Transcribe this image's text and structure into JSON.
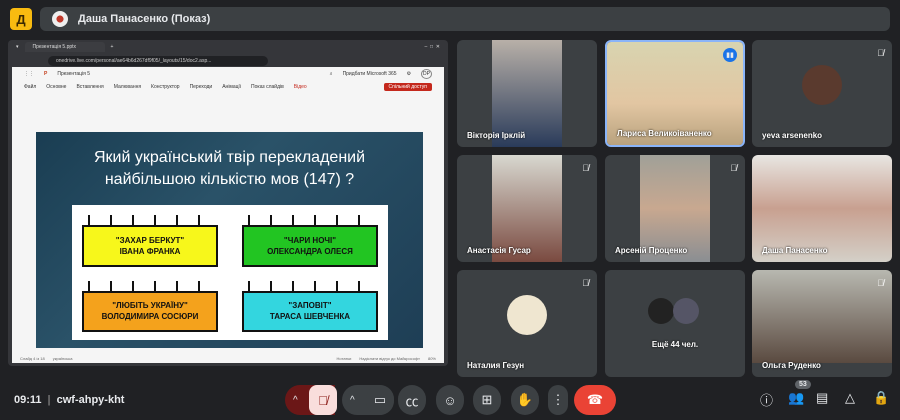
{
  "header": {
    "logo_letter": "Д",
    "presenter": "Даша Панасенко (Показ)"
  },
  "browser": {
    "tab_title": "Презентація 5.pptx",
    "url": "onedrive.live.com/personal/ae64b6d267df9f05/_layouts/15/doc2.asp...",
    "doc_name": "Презентація 5",
    "buy_label": "Придбати Microsoft 365",
    "user_initials": "DP",
    "menu": [
      "Файл",
      "Основне",
      "Вставлення",
      "Малювання",
      "Конструктор",
      "Переходи",
      "Анімації",
      "Показ слайдів",
      "Відео"
    ],
    "share_label": "Спільний доступ",
    "status_left": [
      "Слайд 4 із 18",
      "українська"
    ],
    "status_right": [
      "Нотатки",
      "Надіслати відгук до Майкрософт"
    ],
    "zoom": "80%"
  },
  "slide": {
    "question_line1": "Який український твір перекладений",
    "question_line2": "найбільшою кількістю мов (147) ?",
    "options": [
      {
        "l1": "\"ЗАХАР БЕРКУТ\"",
        "l2": "ІВАНА ФРАНКА",
        "color": "#f7f71b"
      },
      {
        "l1": "\"ЧАРИ НОЧІ\"",
        "l2": "ОЛЕКСАНДРА ОЛЕСЯ",
        "color": "#22c522"
      },
      {
        "l1": "\"ЛЮБІТЬ УКРАЇНУ\"",
        "l2": "ВОЛОДИМИРА СОСЮРИ",
        "color": "#f4a21c"
      },
      {
        "l1": "\"ЗАПОВІТ\"",
        "l2": "ТАРАСА ШЕВЧЕНКА",
        "color": "#33d6df"
      }
    ]
  },
  "participants": [
    {
      "name": "Вікторія Ірклій",
      "muted": false
    },
    {
      "name": "Лариса Великоіваненко",
      "muted": false,
      "speaking": true
    },
    {
      "name": "yeva arsenenko",
      "muted": true
    },
    {
      "name": "Анастасія Гусар",
      "muted": true
    },
    {
      "name": "Арсеній Проценко",
      "muted": true
    },
    {
      "name": "Даша Панасенко",
      "muted": false
    },
    {
      "name": "Наталия Гезун",
      "muted": true
    },
    {
      "name": "Ещё 44 чел."
    },
    {
      "name": "Ольга Руденко",
      "muted": true
    }
  ],
  "footer": {
    "time": "09:11",
    "meeting_code": "cwf-ahpy-kht",
    "people_count": "53"
  }
}
